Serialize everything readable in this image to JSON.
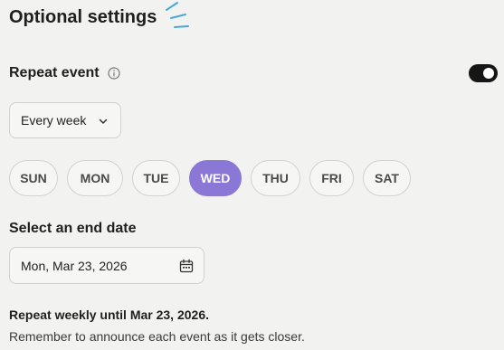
{
  "section": {
    "title": "Optional settings"
  },
  "repeat": {
    "label": "Repeat event",
    "enabled": true,
    "frequency": "Every week"
  },
  "days": [
    {
      "label": "SUN",
      "selected": false
    },
    {
      "label": "MON",
      "selected": false
    },
    {
      "label": "TUE",
      "selected": false
    },
    {
      "label": "WED",
      "selected": true
    },
    {
      "label": "THU",
      "selected": false
    },
    {
      "label": "FRI",
      "selected": false
    },
    {
      "label": "SAT",
      "selected": false
    }
  ],
  "end_date": {
    "label": "Select an end date",
    "value": "Mon, Mar 23, 2026"
  },
  "summary": "Repeat weekly until Mar 23, 2026.",
  "note": "Remember to announce each event as it gets closer.",
  "icons": {
    "info": "info-icon",
    "chevron": "chevron-down-icon",
    "calendar": "calendar-icon",
    "decoration": "sparkle-lines-icon"
  },
  "colors": {
    "accent": "#8b78d6",
    "accent_decoration": "#4aa8d8",
    "toggle_on": "#161616",
    "background": "#f2f2f0"
  }
}
